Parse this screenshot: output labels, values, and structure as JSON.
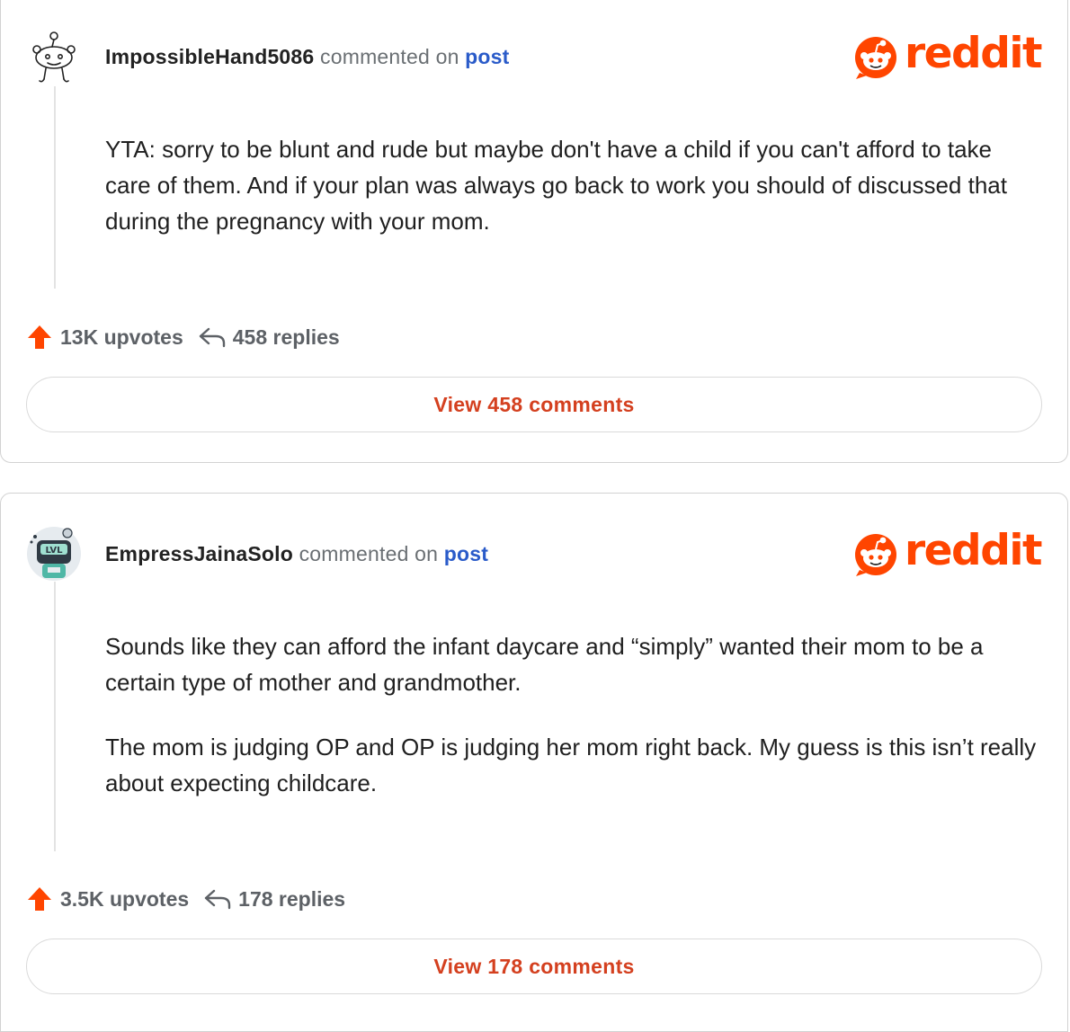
{
  "comments": [
    {
      "username": "ImpossibleHand5086",
      "commented_on": "commented on",
      "post_link": "post",
      "logo_text": "reddit",
      "paragraphs": [
        "YTA: sorry to be blunt and rude but maybe don't have a child if you can't afford to take care of them. And if your plan was always go back to work you should of discussed that during the pregnancy with your mom."
      ],
      "upvotes": "13K upvotes",
      "replies": "458 replies",
      "view_button": "View 458 comments",
      "avatar_icon": "snoo-outline-avatar-icon"
    },
    {
      "username": "EmpressJainaSolo",
      "commented_on": "commented on",
      "post_link": "post",
      "logo_text": "reddit",
      "paragraphs": [
        "Sounds like they can afford the infant daycare and “simply” wanted their mom to be a certain type of mother and grandmother.",
        "The mom is judging OP and OP is judging her mom right back. My guess is this isn’t really about expecting childcare."
      ],
      "upvotes": "3.5K upvotes",
      "replies": "178 replies",
      "view_button": "View 178 comments",
      "avatar_icon": "snoo-robot-avatar-icon"
    }
  ],
  "colors": {
    "brand": "#ff4500",
    "link": "#2a5bc9",
    "button_text": "#d4401f",
    "muted": "#6a6f73"
  },
  "icons": [
    "upvote-arrow-icon",
    "reply-arrow-icon",
    "reddit-logo-icon"
  ]
}
